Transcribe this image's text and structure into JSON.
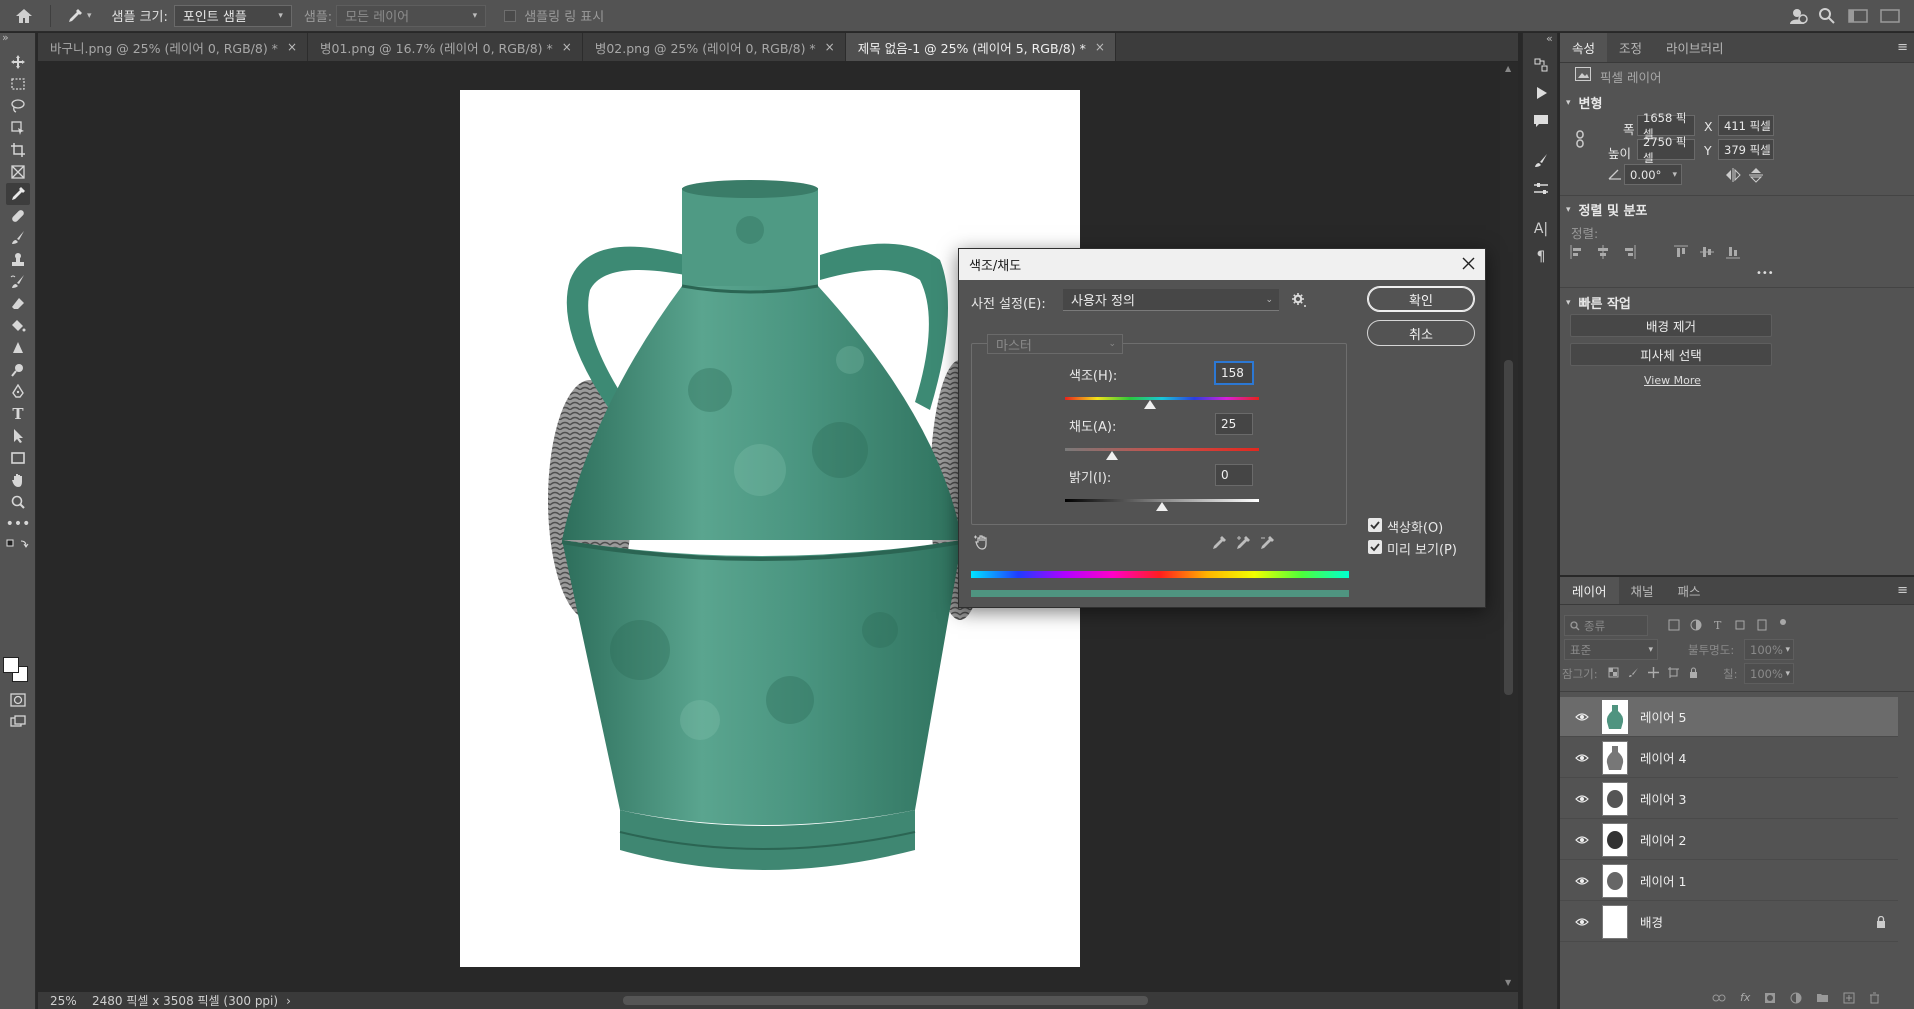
{
  "option_bar": {
    "sample_size_label": "샘플 크기:",
    "sample_size_value": "포인트 샘플",
    "sample_label": "샘플:",
    "sample_value": "모든 레이어",
    "show_ring_label": "샘플링 링 표시"
  },
  "tabs": [
    {
      "label": "바구니.png @ 25% (레이어 0, RGB/8) *",
      "close": "×"
    },
    {
      "label": "병01.png @ 16.7% (레이어 0, RGB/8) *",
      "close": "×"
    },
    {
      "label": "병02.png @ 25% (레이어 0, RGB/8) *",
      "close": "×"
    },
    {
      "label": "제목 없음-1 @ 25% (레이어 5, RGB/8) *",
      "close": "×"
    }
  ],
  "status": {
    "zoom": "25%",
    "doc_info": "2480 픽셀 x 3508 픽셀 (300 ppi)",
    "arrow": "›"
  },
  "properties": {
    "tabs": [
      "속성",
      "조정",
      "라이브러리"
    ],
    "layer_type": "픽셀 레이어",
    "transform_title": "변형",
    "w_label": "폭",
    "w_value": "1658 픽셀",
    "h_label": "높이",
    "h_value": "2750 픽셀",
    "x_label": "X",
    "x_value": "411 픽셀",
    "y_label": "Y",
    "y_value": "379 픽셀",
    "angle_value": "0.00°",
    "align_title": "정렬 및 분포",
    "align_label": "정렬:",
    "more": "•••",
    "quick_title": "빠른 작업",
    "remove_bg": "배경 제거",
    "select_subject": "피사체 선택",
    "view_more": "View More"
  },
  "layers_panel": {
    "tabs": [
      "레이어",
      "채널",
      "패스"
    ],
    "search_placeholder": "종류",
    "blend_mode": "표준",
    "opacity_label": "불투명도:",
    "opacity_value": "100%",
    "lock_label": "잠그기:",
    "fill_label": "칠:",
    "fill_value": "100%",
    "layers": [
      {
        "name": "레이어 5"
      },
      {
        "name": "레이어 4"
      },
      {
        "name": "레이어 3"
      },
      {
        "name": "레이어 2"
      },
      {
        "name": "레이어 1"
      },
      {
        "name": "배경"
      }
    ]
  },
  "dialog": {
    "title": "색조/채도",
    "preset_label": "사전 설정(E):",
    "preset_value": "사용자 정의",
    "ok": "확인",
    "cancel": "취소",
    "channel": "마스터",
    "hue_label": "색조(H):",
    "hue_value": "158",
    "sat_label": "채도(A):",
    "sat_value": "25",
    "light_label": "밝기(I):",
    "light_value": "0",
    "colorize_label": "색상화(O)",
    "colorize_checked": true,
    "preview_label": "미리 보기(P)",
    "preview_checked": true,
    "result_color": "#4f9480"
  },
  "colors": {
    "tint": "#3f8d76",
    "accent": "#2c78d4"
  }
}
